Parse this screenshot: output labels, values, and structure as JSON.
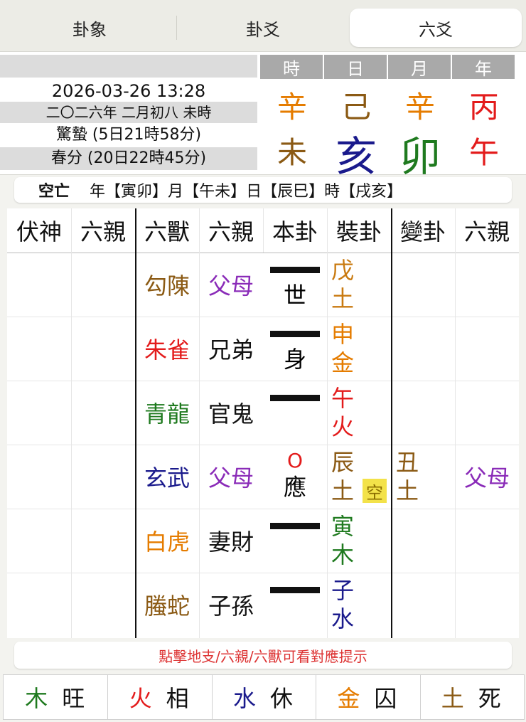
{
  "tabs": [
    "卦象",
    "卦爻",
    "六爻"
  ],
  "info": {
    "datetime": "2026-03-26 13:28",
    "lunar": "二〇二六年 二月初八 未時",
    "jieqi1": "驚蟄 (5日21時58分)",
    "jieqi2": "春分 (20日22時45分)"
  },
  "ganzhi": {
    "headers": [
      "時",
      "日",
      "月",
      "年"
    ],
    "stems": [
      {
        "text": "辛",
        "color": "#e57c00"
      },
      {
        "text": "己",
        "color": "#8b5a14"
      },
      {
        "text": "辛",
        "color": "#e57c00"
      },
      {
        "text": "丙",
        "color": "#e31b1b"
      }
    ],
    "branches": [
      {
        "text": "未",
        "color": "#8b5a14"
      },
      {
        "text": "亥",
        "color": "#1a1a8c"
      },
      {
        "text": "卯",
        "color": "#1f7a1f"
      },
      {
        "text": "午",
        "color": "#e31b1b"
      }
    ]
  },
  "kongwang": {
    "label": "空亡",
    "year_label": "年",
    "year": "【寅卯】",
    "month_label": "月",
    "month": "【午未】",
    "day_label": "日",
    "day": "【辰巳】",
    "hour_label": "時",
    "hour": "【戌亥】"
  },
  "table": {
    "headers": [
      "伏神",
      "六親",
      "六獸",
      "六親",
      "本卦",
      "裝卦",
      "變卦",
      "六親"
    ],
    "rows": [
      {
        "beast": "勾陳",
        "beast_color": "#8b5a14",
        "relative": "父母",
        "rel_color": "#8a2bb8",
        "yao": "yang",
        "mark": "世",
        "najia1": "戊",
        "najia2": "土",
        "najia_color": "#c97a10",
        "empty": "",
        "change1": "",
        "change2": "",
        "change_color": "",
        "change_rel": "",
        "change_rel_color": ""
      },
      {
        "beast": "朱雀",
        "beast_color": "#e31b1b",
        "relative": "兄弟",
        "rel_color": "#111111",
        "yao": "yang",
        "mark": "身",
        "najia1": "申",
        "najia2": "金",
        "najia_color": "#e57c00",
        "empty": "",
        "change1": "",
        "change2": "",
        "change_color": "",
        "change_rel": "",
        "change_rel_color": ""
      },
      {
        "beast": "青龍",
        "beast_color": "#1f7a1f",
        "relative": "官鬼",
        "rel_color": "#111111",
        "yao": "yang",
        "mark": "",
        "najia1": "午",
        "najia2": "火",
        "najia_color": "#e31b1b",
        "empty": "",
        "change1": "",
        "change2": "",
        "change_color": "",
        "change_rel": "",
        "change_rel_color": ""
      },
      {
        "beast": "玄武",
        "beast_color": "#1a1a8c",
        "relative": "父母",
        "rel_color": "#8a2bb8",
        "yao": "moving-yin",
        "yao_label": "O",
        "mark": "應",
        "najia1": "辰",
        "najia2": "土",
        "najia_color": "#8b5a14",
        "empty": "空",
        "change1": "丑",
        "change2": "土",
        "change_color": "#8b5a14",
        "change_rel": "父母",
        "change_rel_color": "#8a2bb8"
      },
      {
        "beast": "白虎",
        "beast_color": "#e57c00",
        "relative": "妻財",
        "rel_color": "#111111",
        "yao": "yang",
        "mark": "",
        "najia1": "寅",
        "najia2": "木",
        "najia_color": "#1f7a1f",
        "empty": "",
        "change1": "",
        "change2": "",
        "change_color": "",
        "change_rel": "",
        "change_rel_color": ""
      },
      {
        "beast": "螣蛇",
        "beast_color": "#8b5a14",
        "relative": "子孫",
        "rel_color": "#111111",
        "yao": "yang",
        "mark": "",
        "najia1": "子",
        "najia2": "水",
        "najia_color": "#1a1a8c",
        "empty": "",
        "change1": "",
        "change2": "",
        "change_color": "",
        "change_rel": "",
        "change_rel_color": ""
      }
    ]
  },
  "hint": "點擊地支/六親/六獸可看對應提示",
  "states": [
    {
      "el": "木",
      "state": "旺",
      "color": "#1f7a1f"
    },
    {
      "el": "火",
      "state": "相",
      "color": "#e31b1b"
    },
    {
      "el": "水",
      "state": "休",
      "color": "#1a1a8c"
    },
    {
      "el": "金",
      "state": "囚",
      "color": "#e57c00"
    },
    {
      "el": "土",
      "state": "死",
      "color": "#8b5a14"
    }
  ]
}
